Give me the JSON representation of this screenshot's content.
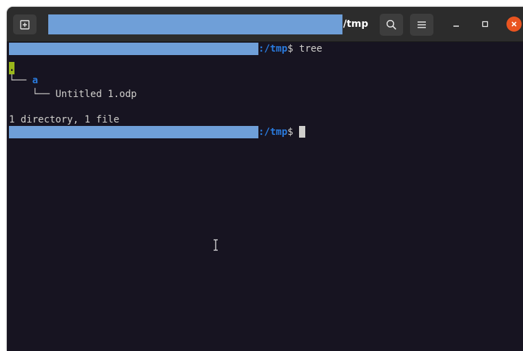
{
  "window": {
    "title_suffix": "/tmp",
    "colors": {
      "terminal_bg": "#171421",
      "titlebar_bg": "#2c2c2c",
      "redaction": "#6f9fd8",
      "path_blue": "#2a7bde",
      "highlight_green": "#9ab71b",
      "close_orange": "#e95420"
    }
  },
  "toolbar": {
    "new_tab_icon": "new-tab-icon",
    "search_icon": "search-icon",
    "menu_icon": "hamburger-menu-icon",
    "minimize_icon": "minimize-icon",
    "maximize_icon": "maximize-icon",
    "close_icon": "close-icon"
  },
  "terminal": {
    "prompt_path": ":/tmp",
    "prompt_symbol": "$ ",
    "command": "tree",
    "tree_root": ".",
    "tree_branch_1": "└── ",
    "tree_dir": "a",
    "tree_branch_2": "    └── ",
    "tree_file": "Untitled 1.odp",
    "summary": "1 directory, 1 file"
  }
}
